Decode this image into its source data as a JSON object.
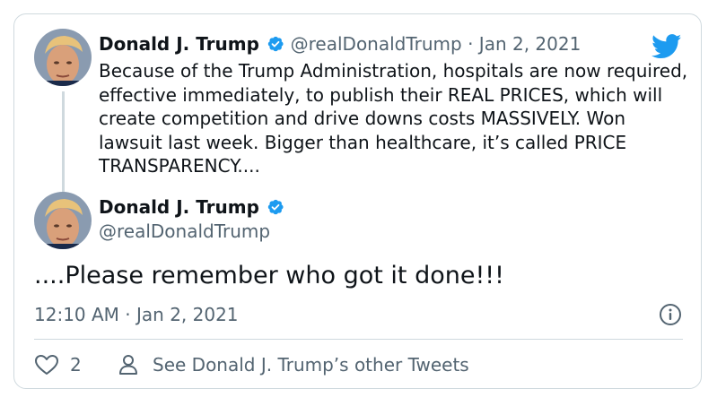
{
  "tweet1": {
    "author_name": "Donald J. Trump",
    "handle": "@realDonaldTrump",
    "separator": "·",
    "date": "Jan 2, 2021",
    "text": "Because of the Trump Administration, hospitals are now required, effective immediately, to publish their REAL PRICES, which will create competition and drive downs costs MASSIVELY. Won lawsuit last week. Bigger than healthcare, it’s called PRICE TRANSPARENCY...."
  },
  "tweet2": {
    "author_name": "Donald J. Trump",
    "handle": "@realDonaldTrump",
    "text": "....Please remember who got it done!!!",
    "timestamp": "12:10 AM · Jan 2, 2021"
  },
  "actions": {
    "like_count": "2",
    "other_tweets_label": "See Donald J. Trump’s other Tweets"
  },
  "icons": {
    "brand": "twitter-bird-icon",
    "verified": "verified-badge-icon",
    "info": "info-icon",
    "like": "heart-icon",
    "profile": "person-icon"
  },
  "colors": {
    "twitter_blue": "#1d9bf0",
    "text_primary": "#0f1419",
    "text_secondary": "#536471",
    "border": "#cfd9de"
  }
}
